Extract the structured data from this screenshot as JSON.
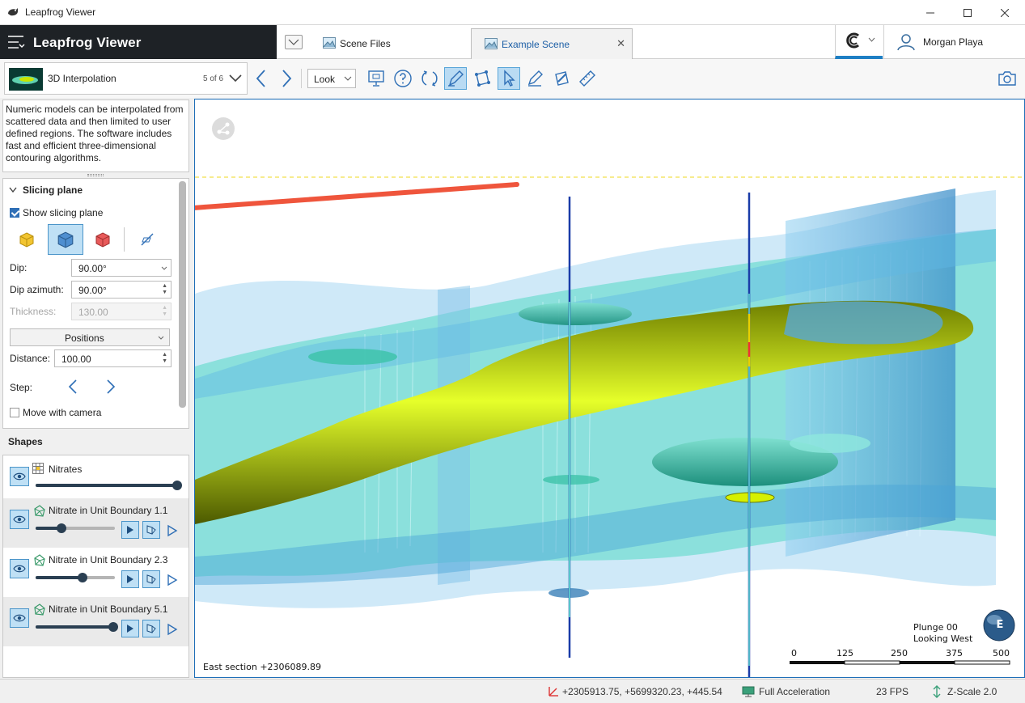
{
  "window": {
    "title": "Leapfrog Viewer"
  },
  "header": {
    "brand": "Leapfrog Viewer",
    "tabs": [
      {
        "label": "Scene Files"
      },
      {
        "label": "Example Scene"
      }
    ],
    "user_name": "Morgan Playa"
  },
  "toolbar": {
    "scene_name": "3D Interpolation",
    "scene_count": "5 of 6",
    "look_label": "Look"
  },
  "description": "Numeric models can be interpolated from scattered data and then limited to user defined regions. The software includes fast and efficient three-dimensional contouring algorithms.",
  "slicing_plane": {
    "title": "Slicing plane",
    "show_label": "Show slicing plane",
    "show_checked": true,
    "dip_label": "Dip:",
    "dip_value": "90.00°",
    "dip_azimuth_label": "Dip azimuth:",
    "dip_azimuth_value": "90.00°",
    "thickness_label": "Thickness:",
    "thickness_value": "130.00",
    "positions_label": "Positions",
    "distance_label": "Distance:",
    "distance_value": "100.00",
    "step_label": "Step:",
    "move_with_camera_label": "Move with camera",
    "move_with_camera_checked": false
  },
  "shapes": {
    "title": "Shapes",
    "items": [
      {
        "name": "Nitrates",
        "opacity": 1.0
      },
      {
        "name": "Nitrate in Unit Boundary 1.1",
        "opacity": 0.33
      },
      {
        "name": "Nitrate in Unit Boundary 2.3",
        "opacity": 0.59
      },
      {
        "name": "Nitrate in Unit Boundary 5.1",
        "opacity": 0.97
      }
    ]
  },
  "viewport": {
    "section_label": "East section +2306089.89",
    "plunge": "Plunge 00",
    "looking": "Looking West",
    "compass_letter": "E",
    "scale_ticks": [
      "0",
      "125",
      "250",
      "375",
      "500"
    ]
  },
  "status": {
    "coordinates": "+2305913.75, +5699320.23, +445.54",
    "acceleration": "Full Acceleration",
    "fps": "23 FPS",
    "zscale": "Z-Scale 2.0"
  },
  "colors": {
    "brand_bg": "#1e2226",
    "accent": "#1e7fc4",
    "active_tool": "#b9dbf3",
    "annotation_arrow": "#ef553c",
    "surface_yellow": "#c8e600",
    "water_blue": "#6ab8e6"
  }
}
